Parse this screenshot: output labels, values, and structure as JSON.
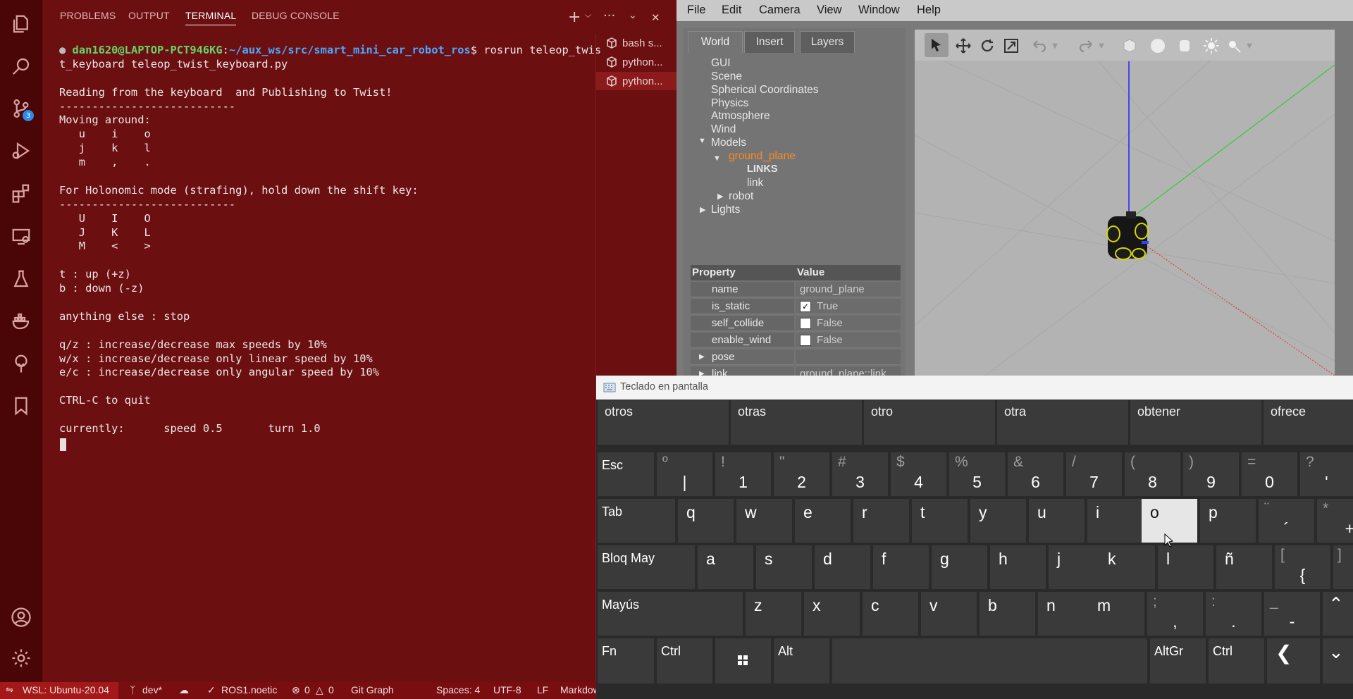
{
  "vscode": {
    "activity_badge": "3",
    "panel_tabs": [
      "PROBLEMS",
      "OUTPUT",
      "TERMINAL",
      "DEBUG CONSOLE"
    ],
    "panel_actions": {
      "new_terminal": "+",
      "more": "···",
      "close": "✕"
    },
    "terminal": {
      "prompt_user": "dan1620@LAPTOP-PCT946KG",
      "prompt_path": "~/aux_ws/src/smart_mini_car_robot_ros",
      "command": "$ rosrun teleop_twis",
      "lines": [
        "t_keyboard teleop_twist_keyboard.py",
        "",
        "Reading from the keyboard  and Publishing to Twist!",
        "---------------------------",
        "Moving around:",
        "   u    i    o",
        "   j    k    l",
        "   m    ,    .",
        "",
        "For Holonomic mode (strafing), hold down the shift key:",
        "---------------------------",
        "   U    I    O",
        "   J    K    L",
        "   M    <    >",
        "",
        "t : up (+z)",
        "b : down (-z)",
        "",
        "anything else : stop",
        "",
        "q/z : increase/decrease max speeds by 10%",
        "w/x : increase/decrease only linear speed by 10%",
        "e/c : increase/decrease only angular speed by 10%",
        "",
        "CTRL-C to quit",
        "",
        "currently:      speed 0.5       turn 1.0"
      ]
    },
    "terminal_list": [
      "bash s...",
      "python...",
      "python..."
    ],
    "status": {
      "remote": "WSL: Ubuntu-20.04",
      "branch": "dev*",
      "ros": "ROS1.noetic",
      "errors": "0",
      "warnings": "0",
      "git_graph": "Git Graph",
      "spaces": "Spaces: 4",
      "encoding": "UTF-8",
      "eol": "LF",
      "language": "Markdown"
    }
  },
  "gazebo": {
    "menu": [
      "File",
      "Edit",
      "Camera",
      "View",
      "Window",
      "Help"
    ],
    "tabs": [
      "World",
      "Insert",
      "Layers"
    ],
    "tree": {
      "gui": "GUI",
      "scene": "Scene",
      "spherical": "Spherical Coordinates",
      "physics": "Physics",
      "atmosphere": "Atmosphere",
      "wind": "Wind",
      "models": "Models",
      "ground_plane": "ground_plane",
      "links": "LINKS",
      "link": "link",
      "robot": "robot",
      "lights": "Lights"
    },
    "properties": {
      "header_property": "Property",
      "header_value": "Value",
      "rows": [
        {
          "name": "name",
          "value": "ground_plane"
        },
        {
          "name": "is_static",
          "value": "True"
        },
        {
          "name": "self_collide",
          "value": "False"
        },
        {
          "name": "enable_wind",
          "value": "False"
        },
        {
          "name": "pose",
          "value": ""
        },
        {
          "name": "link",
          "value": "ground_plane::link"
        }
      ]
    }
  },
  "keyboard": {
    "title": "Teclado en pantalla",
    "suggestions": [
      "otros",
      "otras",
      "otro",
      "otra",
      "obtener",
      "ofrece"
    ],
    "row1": [
      {
        "top": "Esc",
        "main": ""
      },
      {
        "top": "º",
        "main": "|"
      },
      {
        "top": "!",
        "main": "1"
      },
      {
        "top": "\"",
        "main": "2"
      },
      {
        "top": "#",
        "main": "3"
      },
      {
        "top": "$",
        "main": "4"
      },
      {
        "top": "%",
        "main": "5"
      },
      {
        "top": "&",
        "main": "6"
      },
      {
        "top": "/",
        "main": "7"
      },
      {
        "top": "(",
        "main": "8"
      },
      {
        "top": ")",
        "main": "9"
      },
      {
        "top": "=",
        "main": "0"
      },
      {
        "top": "?",
        "main": "'"
      }
    ],
    "row2": [
      "Tab",
      "q",
      "w",
      "e",
      "r",
      "t",
      "y",
      "u",
      "i",
      "o",
      "p",
      "¨",
      "*"
    ],
    "row2_extra": {
      "acute": "´",
      "plus": "+"
    },
    "row3": [
      "Bloq May",
      "a",
      "s",
      "d",
      "f",
      "g",
      "h",
      "j",
      "k",
      "l",
      "ñ",
      "["
    ],
    "row3_extra": {
      "brace": "{"
    },
    "row4": [
      "Mayús",
      "z",
      "x",
      "c",
      "v",
      "b",
      "n",
      "m"
    ],
    "row4_punct": [
      {
        "top": ";",
        "main": ","
      },
      {
        "top": ":",
        "main": "."
      },
      {
        "top": "_",
        "main": "-"
      }
    ],
    "row5": {
      "fn": "Fn",
      "ctrl": "Ctrl",
      "alt": "Alt",
      "altgr": "AltGr",
      "ctrl2": "Ctrl"
    },
    "pressed_key": "o"
  }
}
